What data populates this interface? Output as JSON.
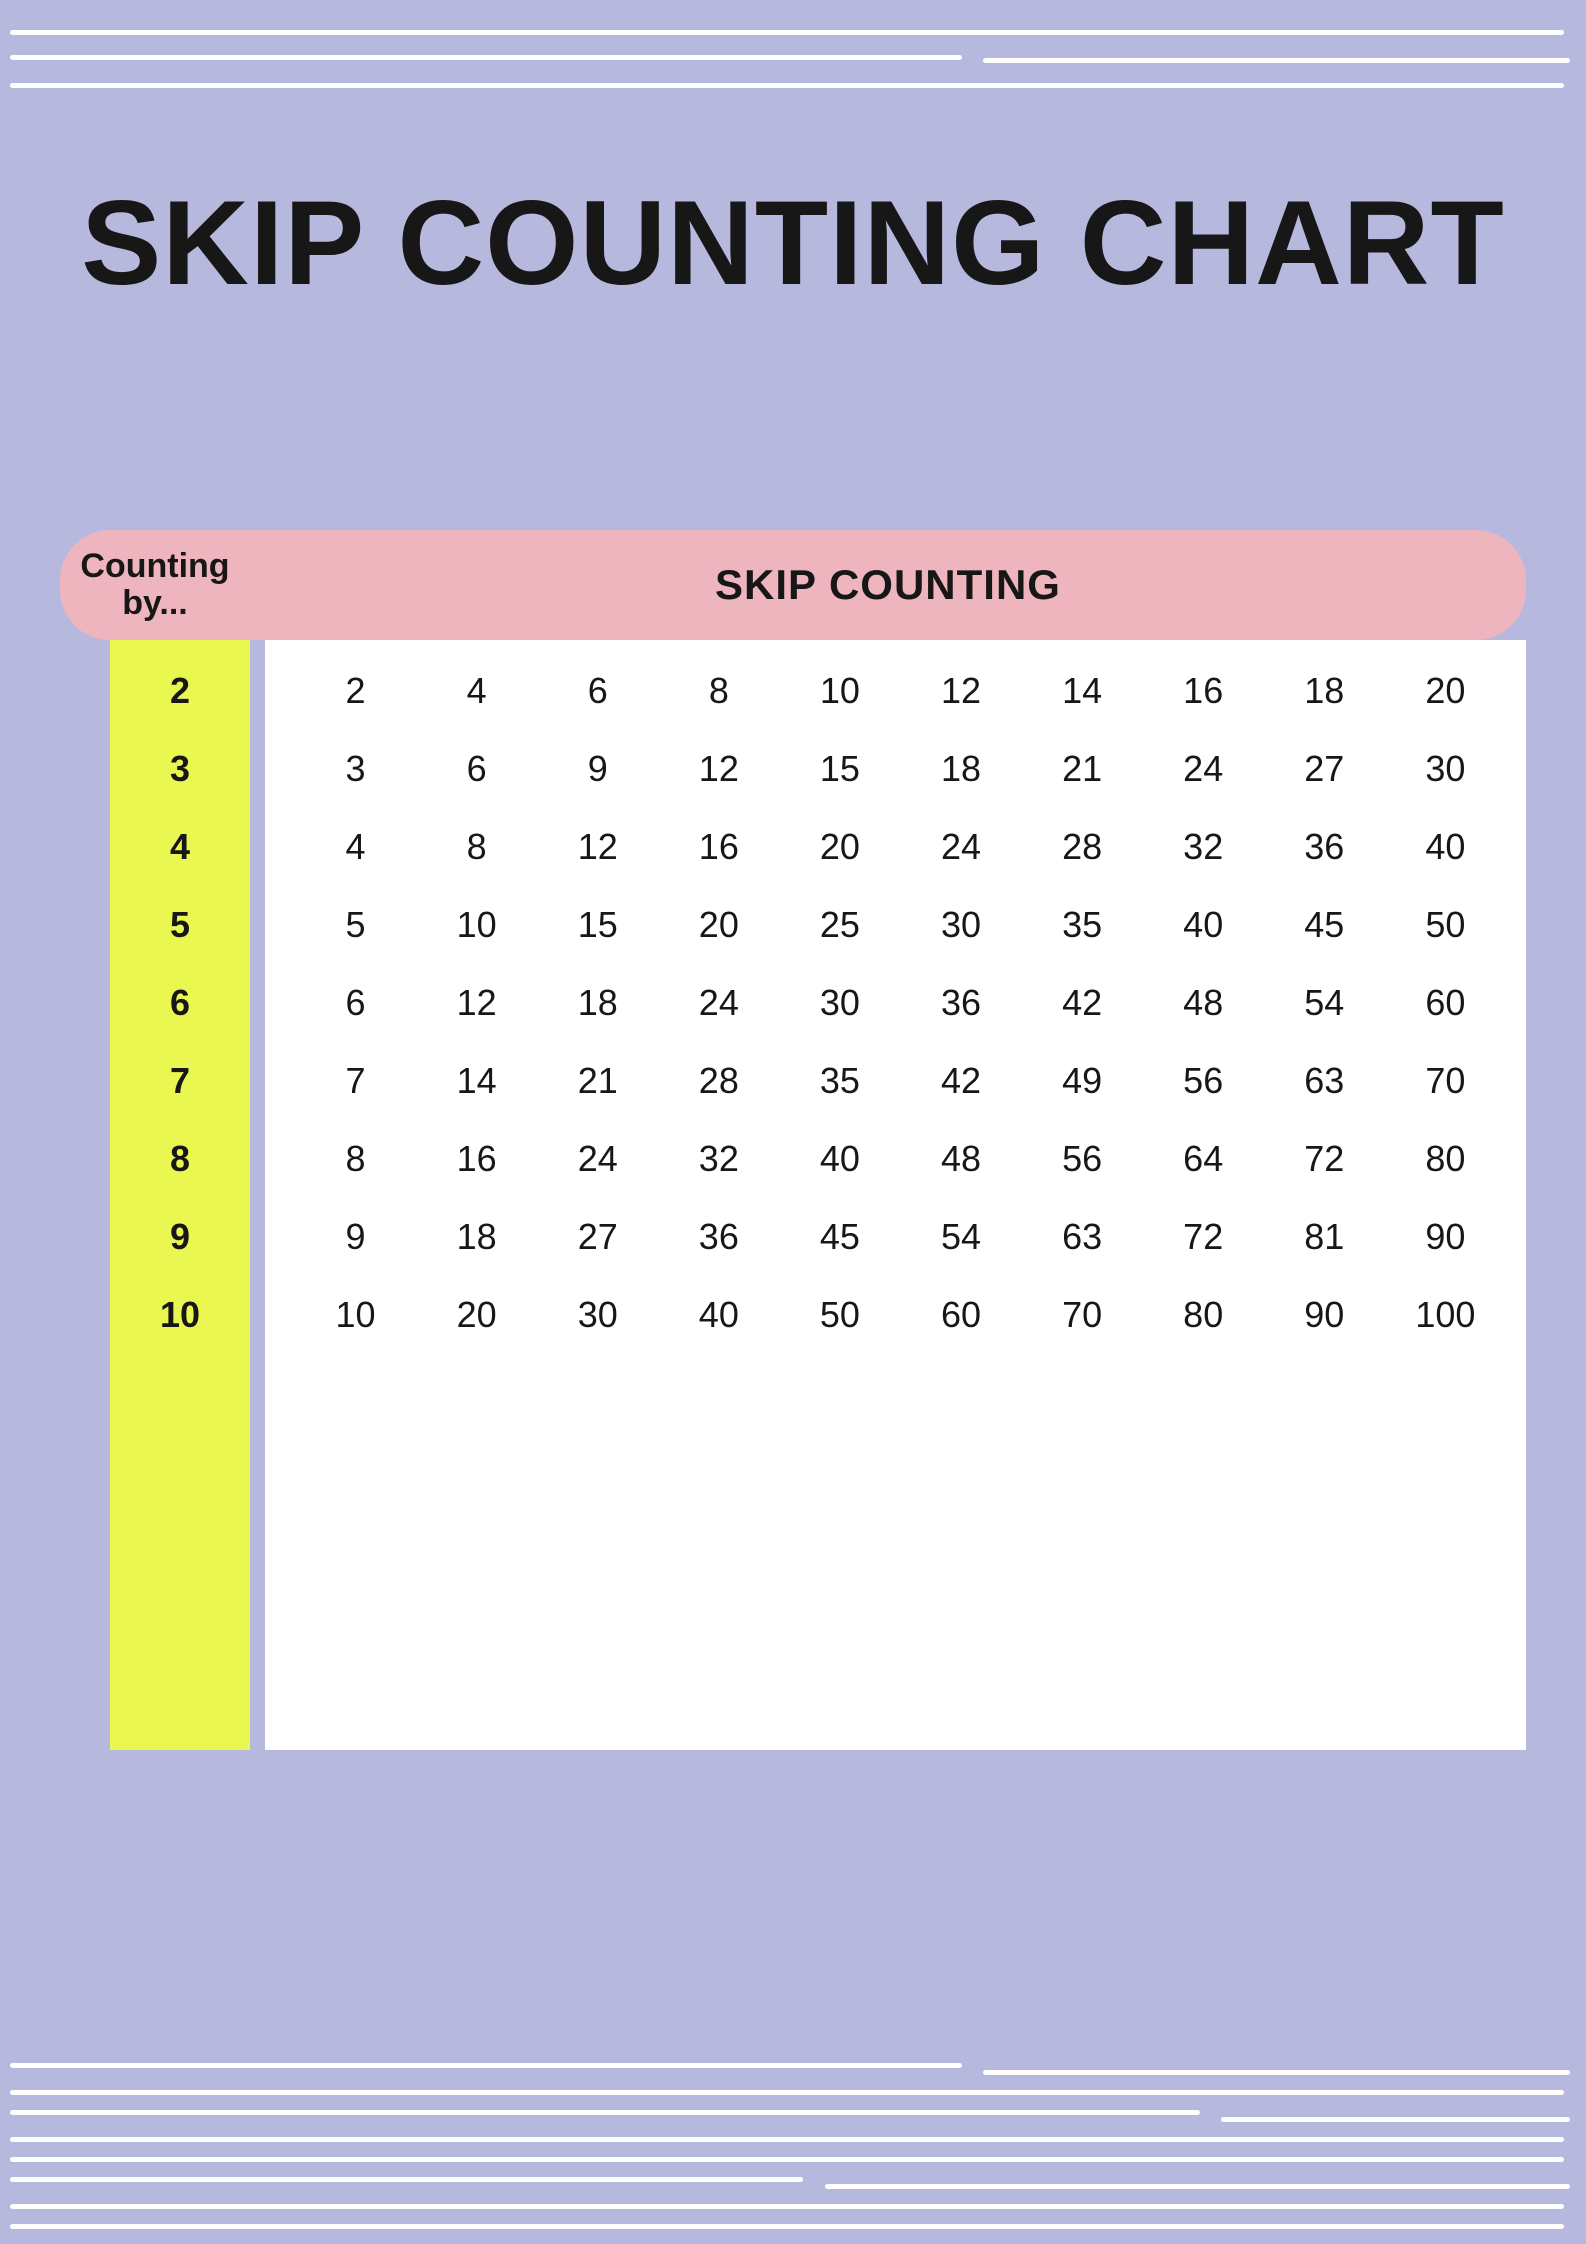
{
  "title": "SKIP COUNTING CHART",
  "header_left": "Counting by...",
  "header_right": "SKIP COUNTING",
  "chart_data": {
    "type": "table",
    "title": "SKIP COUNTING CHART",
    "xlabel": "SKIP COUNTING",
    "ylabel": "Counting by...",
    "categories": [
      2,
      3,
      4,
      5,
      6,
      7,
      8,
      9,
      10
    ],
    "series": [
      {
        "name": "2",
        "values": [
          2,
          4,
          6,
          8,
          10,
          12,
          14,
          16,
          18,
          20
        ]
      },
      {
        "name": "3",
        "values": [
          3,
          6,
          9,
          12,
          15,
          18,
          21,
          24,
          27,
          30
        ]
      },
      {
        "name": "4",
        "values": [
          4,
          8,
          12,
          16,
          20,
          24,
          28,
          32,
          36,
          40
        ]
      },
      {
        "name": "5",
        "values": [
          5,
          10,
          15,
          20,
          25,
          30,
          35,
          40,
          45,
          50
        ]
      },
      {
        "name": "6",
        "values": [
          6,
          12,
          18,
          24,
          30,
          36,
          42,
          48,
          54,
          60
        ]
      },
      {
        "name": "7",
        "values": [
          7,
          14,
          21,
          28,
          35,
          42,
          49,
          56,
          63,
          70
        ]
      },
      {
        "name": "8",
        "values": [
          8,
          16,
          24,
          32,
          40,
          48,
          56,
          64,
          72,
          80
        ]
      },
      {
        "name": "9",
        "values": [
          9,
          18,
          27,
          36,
          45,
          54,
          63,
          72,
          81,
          90
        ]
      },
      {
        "name": "10",
        "values": [
          10,
          20,
          30,
          40,
          50,
          60,
          70,
          80,
          90,
          100
        ]
      }
    ]
  }
}
